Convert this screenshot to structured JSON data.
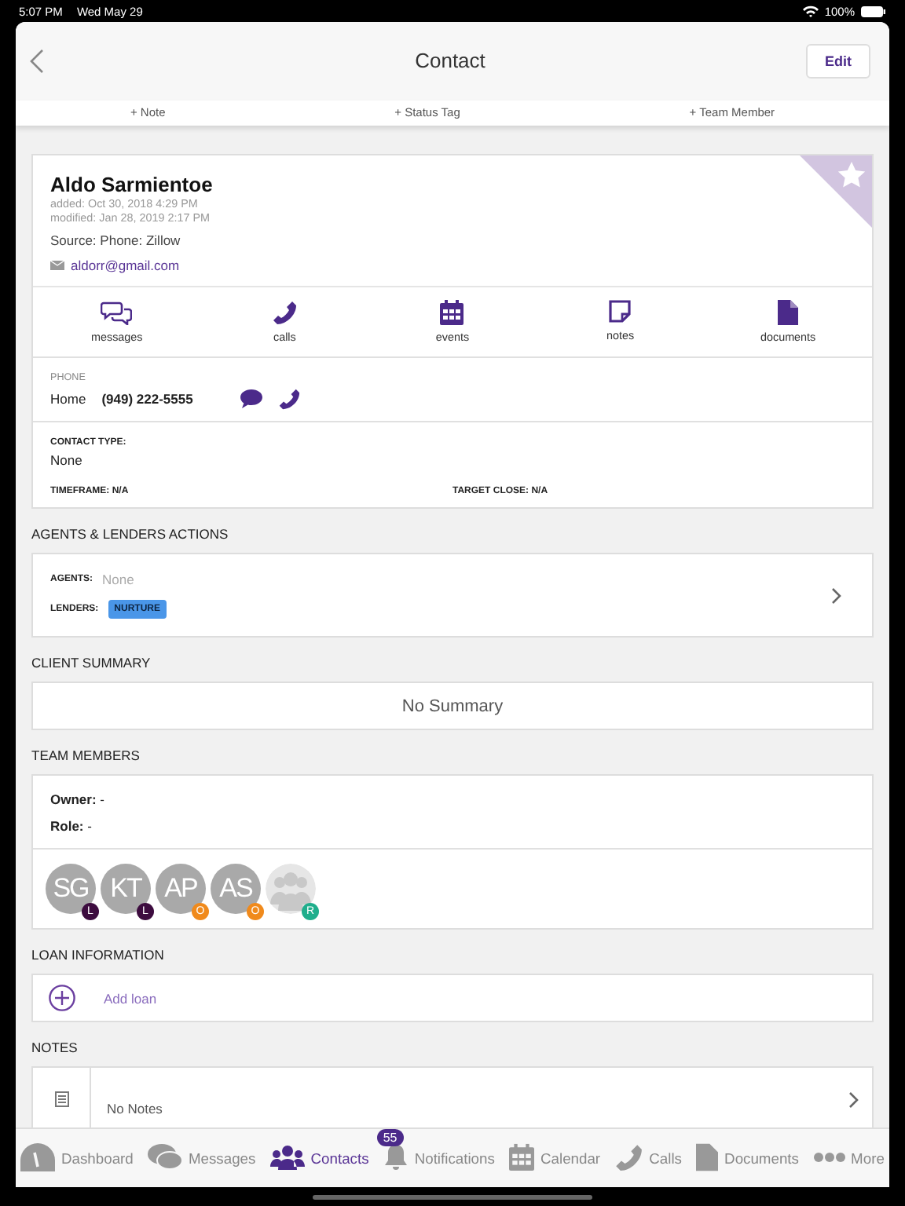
{
  "status_bar": {
    "time": "5:07 PM",
    "date": "Wed May 29",
    "battery": "100%"
  },
  "nav": {
    "title": "Contact",
    "edit": "Edit"
  },
  "quick_actions": [
    "+ Note",
    "+ Status Tag",
    "+ Team Member"
  ],
  "contact": {
    "name": "Aldo Sarmientoe",
    "added": "added: Oct 30, 2018 4:29 PM",
    "modified": "modified: Jan 28, 2019 2:17 PM",
    "source_label": "Source:",
    "source": "Phone: Zillow",
    "email": "aldorr@gmail.com",
    "favorite": true
  },
  "activity_links": [
    {
      "kind": "messages",
      "label": "messages"
    },
    {
      "kind": "calls",
      "label": "calls"
    },
    {
      "kind": "events",
      "label": "events"
    },
    {
      "kind": "notes",
      "label": "notes"
    },
    {
      "kind": "documents",
      "label": "documents"
    }
  ],
  "phone": {
    "heading": "PHONE",
    "type": "Home",
    "number": "(949) 222-5555"
  },
  "details": {
    "contact_type_label": "CONTACT TYPE:",
    "contact_type": "None",
    "timeframe": "TIMEFRAME: N/A",
    "target_close": "TARGET CLOSE: N/A"
  },
  "agents_lenders": {
    "heading": "AGENTS & LENDERS ACTIONS",
    "agents_label": "AGENTS:",
    "agents": "None",
    "lenders_label": "LENDERS:",
    "lender_tag": "NURTURE"
  },
  "client_summary": {
    "heading": "CLIENT SUMMARY",
    "text": "No Summary"
  },
  "team": {
    "heading": "TEAM MEMBERS",
    "owner_label": "Owner:",
    "owner": "-",
    "role_label": "Role:",
    "role": "-",
    "members": [
      {
        "kind": "initials",
        "initials": "SG",
        "role": "L",
        "color": "#3d0c3f"
      },
      {
        "kind": "initials",
        "initials": "KT",
        "role": "L",
        "color": "#3d0c3f"
      },
      {
        "kind": "initials",
        "initials": "AP",
        "role": "O",
        "color": "#f08a1c"
      },
      {
        "kind": "initials",
        "initials": "AS",
        "role": "O",
        "color": "#f08a1c"
      },
      {
        "kind": "silhouette",
        "role": "R",
        "color": "#1fae8c"
      }
    ]
  },
  "loan": {
    "heading": "LOAN INFORMATION",
    "add": "Add loan"
  },
  "notes": {
    "heading": "NOTES",
    "text": "No Notes"
  },
  "tab_bar": [
    {
      "kind": "dashboard",
      "label": "Dashboard",
      "selected": false
    },
    {
      "kind": "messages",
      "label": "Messages",
      "selected": false
    },
    {
      "kind": "contacts",
      "label": "Contacts",
      "selected": true
    },
    {
      "kind": "notifications",
      "label": "Notifications",
      "selected": false,
      "badge": "55"
    },
    {
      "kind": "calendar",
      "label": "Calendar",
      "selected": false
    },
    {
      "kind": "calls",
      "label": "Calls",
      "selected": false
    },
    {
      "kind": "documents",
      "label": "Documents",
      "selected": false
    },
    {
      "kind": "more",
      "label": "More",
      "selected": false
    }
  ]
}
